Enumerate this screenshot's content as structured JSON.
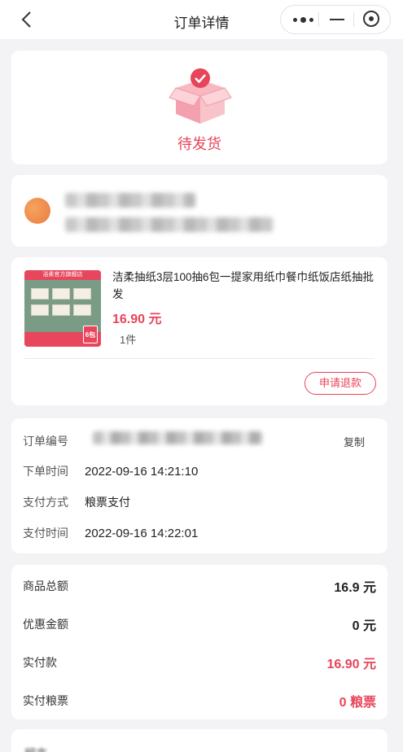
{
  "nav": {
    "title": "订单详情",
    "back_icon": "chevron-left-icon",
    "more_icon": "more-dots-icon",
    "minimize_icon": "minimize-icon",
    "close_icon": "target-close-icon"
  },
  "status": {
    "label": "待发货",
    "icon": "open-box-check-icon",
    "color": "#e8445a"
  },
  "goods": {
    "name": "洁柔抽纸3层100抽6包一提家用纸巾餐巾纸饭店纸抽批发",
    "price": "16.90 元",
    "quantity": "1件",
    "refund_label": "申请退款",
    "image_banner": "洁柔官方旗舰店",
    "image_tag": "6包"
  },
  "order_info": {
    "order_no_label": "订单编号",
    "copy_label": "复制",
    "order_time_label": "下单时间",
    "order_time": "2022-09-16 14:21:10",
    "pay_method_label": "支付方式",
    "pay_method": "粮票支付",
    "pay_time_label": "支付时间",
    "pay_time": "2022-09-16 14:22:01"
  },
  "summary": {
    "total_label": "商品总额",
    "total": "16.9 元",
    "discount_label": "优惠金额",
    "discount": "0 元",
    "paid_label": "实付款",
    "paid": "16.90 元",
    "paid_coupon_label": "实付粮票",
    "paid_coupon": "0 粮票"
  },
  "bottom": {
    "label": "留言"
  },
  "colors": {
    "accent": "#e8445a",
    "background": "#f3f3f5"
  }
}
